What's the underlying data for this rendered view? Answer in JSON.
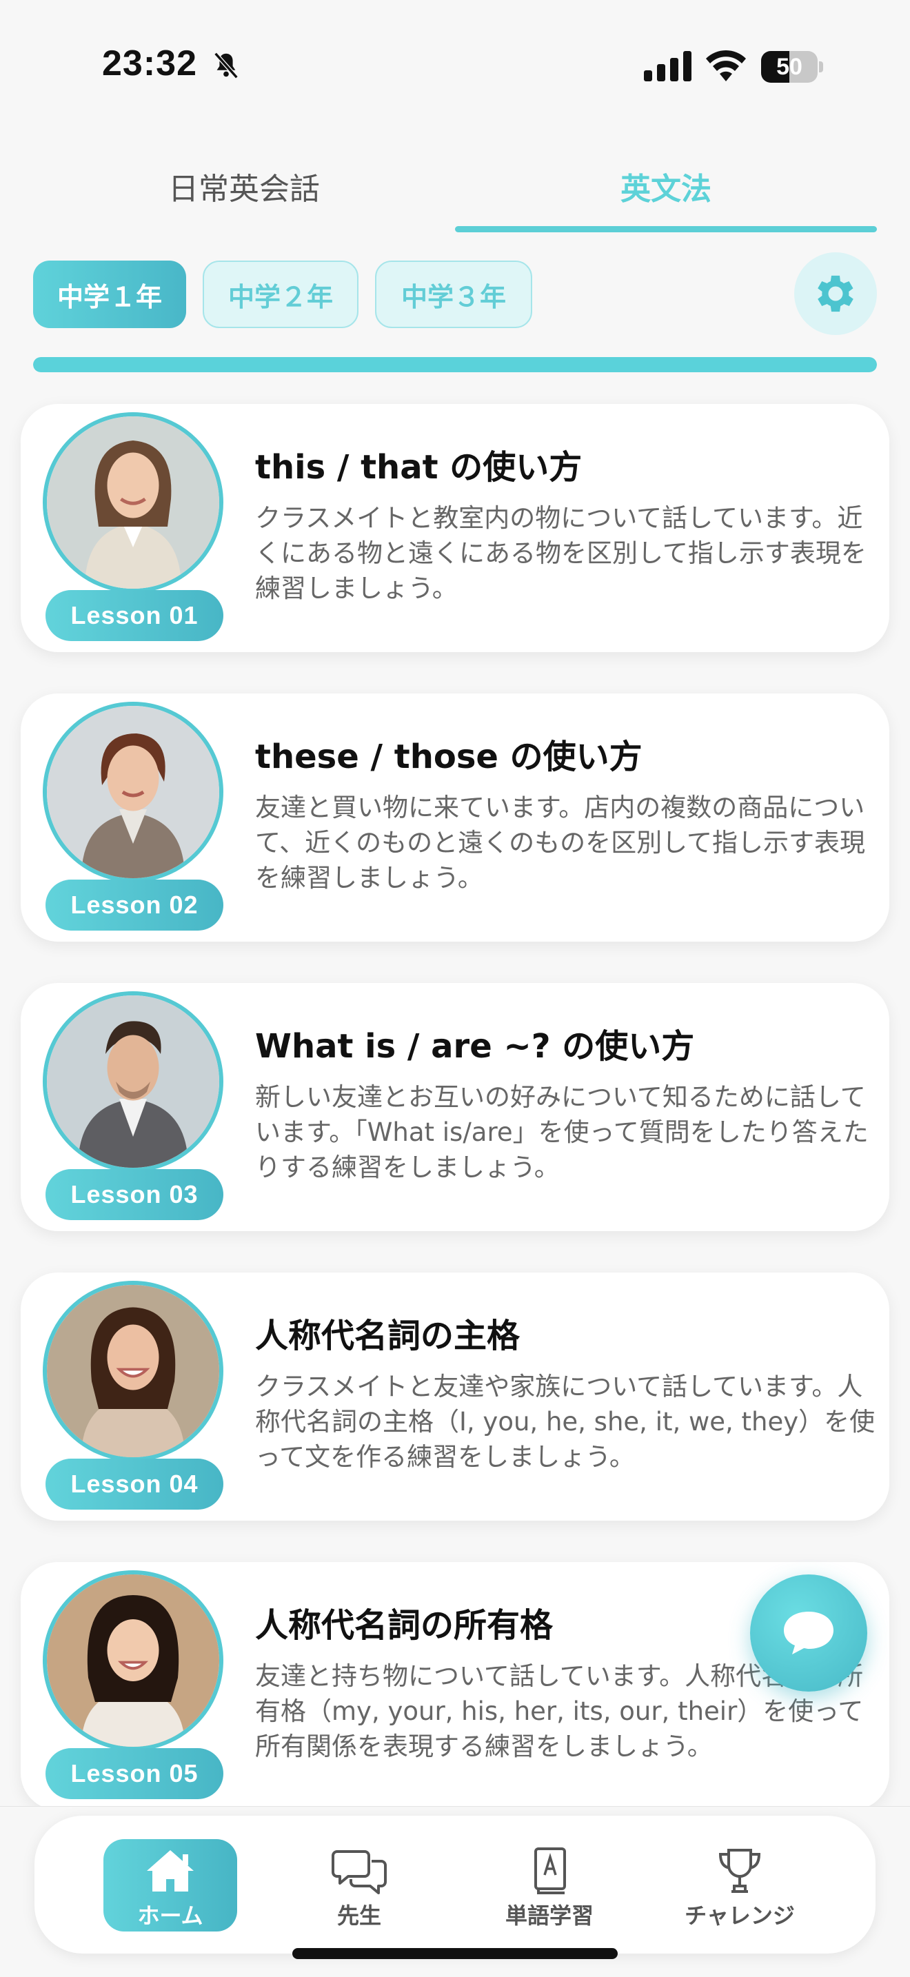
{
  "status_bar": {
    "time": "23:32",
    "battery_level": "50",
    "battery_fraction": 0.5,
    "icons": [
      "bell-slash-icon",
      "cellular-signal-icon",
      "wifi-icon",
      "battery-icon"
    ]
  },
  "top_tabs": [
    {
      "label": "日常英会話",
      "active": false
    },
    {
      "label": "英文法",
      "active": true
    }
  ],
  "grade_chips": [
    {
      "label": "中学１年",
      "active": true
    },
    {
      "label": "中学２年",
      "active": false
    },
    {
      "label": "中学３年",
      "active": false
    }
  ],
  "settings": {
    "icon": "gear-icon"
  },
  "progress": {
    "fraction": 1.0
  },
  "lessons": [
    {
      "badge": "Lesson 01",
      "title": "this / that の使い方",
      "description": "クラスメイトと教室内の物について話しています。近くにある物と遠くにある物を区別して指し示す表現を練習しましょう。"
    },
    {
      "badge": "Lesson 02",
      "title": "these / those の使い方",
      "description": "友達と買い物に来ています。店内の複数の商品について、近くのものと遠くのものを区別して指し示す表現を練習しましょう。"
    },
    {
      "badge": "Lesson 03",
      "title": "What is / are ~? の使い方",
      "description": "新しい友達とお互いの好みについて知るために話しています。「What is/are」を使って質問をしたり答えたりする練習をしましょう。"
    },
    {
      "badge": "Lesson 04",
      "title": "人称代名詞の主格",
      "description": "クラスメイトと友達や家族について話しています。人称代名詞の主格（I, you, he, she, it, we, they）を使って文を作る練習をしましょう。"
    },
    {
      "badge": "Lesson 05",
      "title": "人称代名詞の所有格",
      "description": "友達と持ち物について話しています。人称代名詞の所有格（my, your, his, her, its, our, their）を使って所有関係を表現する練習をしましょう。"
    }
  ],
  "chat_fab": {
    "icon": "chat-bubble-icon"
  },
  "bottom_nav": [
    {
      "label": "ホーム",
      "icon": "home-icon",
      "active": true
    },
    {
      "label": "先生",
      "icon": "chat-bubbles-icon",
      "active": false
    },
    {
      "label": "単語学習",
      "icon": "book-icon",
      "active": false
    },
    {
      "label": "チャレンジ",
      "icon": "trophy-icon",
      "active": false
    }
  ],
  "colors": {
    "accent": "#5dd2d8",
    "accent_dark": "#48b6c6",
    "chip_bg": "#dff6f7",
    "text_gray": "#666666"
  }
}
